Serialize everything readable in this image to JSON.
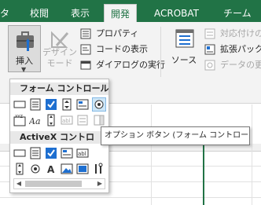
{
  "tabs": [
    {
      "label": "タ",
      "active": false
    },
    {
      "label": "校閲",
      "active": false
    },
    {
      "label": "表示",
      "active": false
    },
    {
      "label": "開発",
      "active": true
    },
    {
      "label": "ACROBAT",
      "active": false
    },
    {
      "label": "チーム",
      "active": false
    }
  ],
  "ribbon": {
    "insert_label": "挿入",
    "design_label_1": "デザイン",
    "design_label_2": "モード",
    "properties_label": "プロパティ",
    "view_code_label": "コードの表示",
    "run_dialog_label": "ダイアログの実行",
    "source_label": "ソース",
    "map_properties_label": "対応付けの",
    "expansion_pack_label": "拡張パック",
    "refresh_data_label": "データの更"
  },
  "dropdown": {
    "form_controls_header": "フォーム コントロール",
    "activex_controls_header": "ActiveX コントロ"
  },
  "tooltip": {
    "text": "オプション ボタン (フォーム コントロール)"
  },
  "colors": {
    "tab_bar": "#217346",
    "ribbon_bg": "#f3f3f3",
    "hover_highlight": "#cde6f7",
    "check_blue": "#1e6fd0"
  }
}
